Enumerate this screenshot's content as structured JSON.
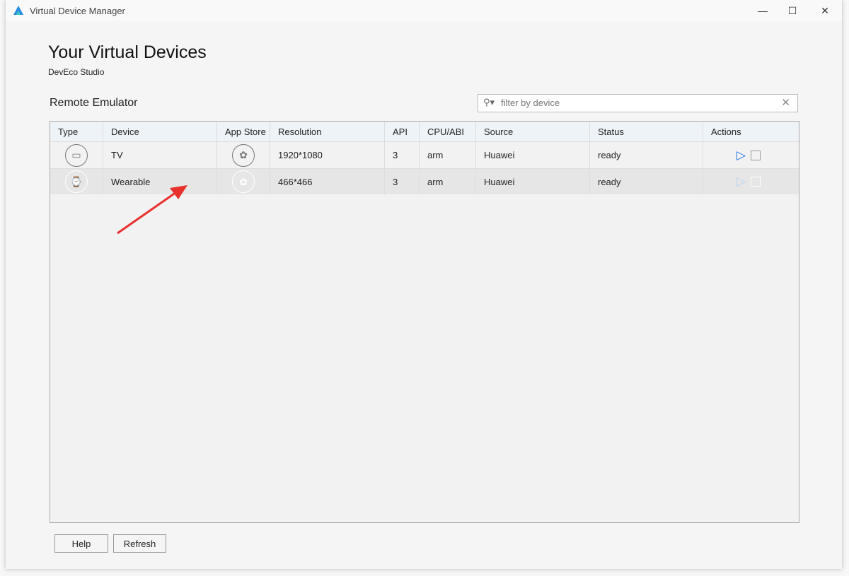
{
  "window": {
    "title": "Virtual Device Manager",
    "minimize": "—",
    "maximize": "☐",
    "close": "✕"
  },
  "header": {
    "title": "Your Virtual Devices",
    "subtitle": "DevEco Studio"
  },
  "section": {
    "title": "Remote Emulator"
  },
  "filter": {
    "placeholder": "filter by device",
    "value": ""
  },
  "table": {
    "columns": [
      "Type",
      "Device",
      "App Store",
      "Resolution",
      "API",
      "CPU/ABI",
      "Source",
      "Status",
      "Actions"
    ],
    "rows": [
      {
        "type_icon": "tv-icon",
        "device": "TV",
        "resolution": "1920*1080",
        "api": "3",
        "cpu": "arm",
        "source": "Huawei",
        "status": "ready"
      },
      {
        "type_icon": "watch-icon",
        "device": "Wearable",
        "resolution": "466*466",
        "api": "3",
        "cpu": "arm",
        "source": "Huawei",
        "status": "ready"
      }
    ]
  },
  "buttons": {
    "help": "Help",
    "refresh": "Refresh"
  },
  "colors": {
    "accent": "#1a73e8",
    "annotation_arrow": "#e8312f"
  }
}
